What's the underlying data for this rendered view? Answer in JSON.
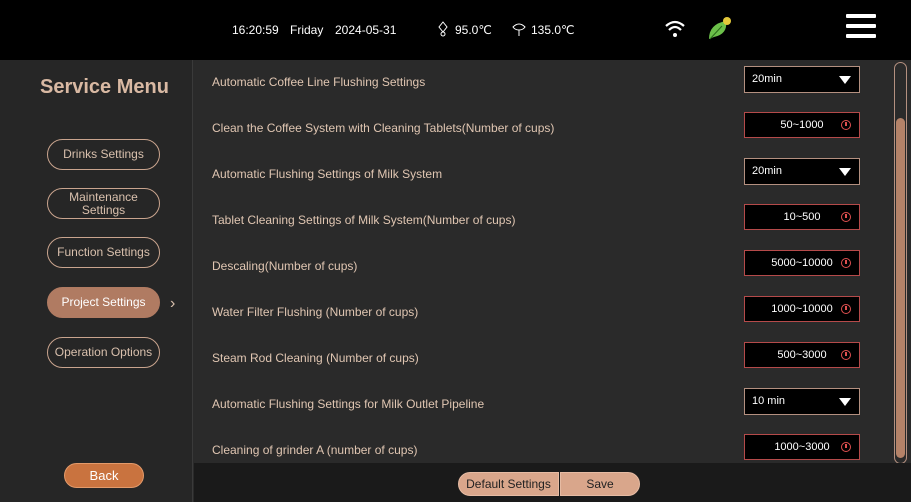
{
  "status_bar": {
    "time": "16:20:59",
    "day": "Friday",
    "date": "2024-05-31",
    "boiler_temp": "95.0℃",
    "steam_temp": "135.0℃",
    "icons": [
      "boiler-icon",
      "steam-icon",
      "wifi-icon",
      "leaf-icon",
      "hamburger-menu-icon"
    ]
  },
  "sidebar": {
    "title": "Service Menu",
    "items": [
      {
        "label": "Drinks Settings"
      },
      {
        "label": "Maintenance Settings"
      },
      {
        "label": "Function Settings"
      },
      {
        "label": "Project Settings",
        "active": true
      },
      {
        "label": "Operation Options"
      }
    ],
    "back_label": "Back"
  },
  "settings": [
    {
      "label": "Automatic Coffee Line Flushing Settings",
      "type": "dropdown",
      "value": "20min"
    },
    {
      "label": "Clean the Coffee System with Cleaning Tablets(Number of cups)",
      "type": "number",
      "placeholder": "50~1000"
    },
    {
      "label": "Automatic Flushing Settings of Milk System",
      "type": "dropdown",
      "value": "20min"
    },
    {
      "label": "Tablet Cleaning Settings of Milk System(Number of cups)",
      "type": "number",
      "placeholder": "10~500"
    },
    {
      "label": "Descaling(Number of cups)",
      "type": "number",
      "placeholder": "5000~10000"
    },
    {
      "label": "Water Filter Flushing (Number of cups)",
      "type": "number",
      "placeholder": "1000~10000"
    },
    {
      "label": "Steam Rod Cleaning (Number of cups)",
      "type": "number",
      "placeholder": "500~3000"
    },
    {
      "label": "Automatic Flushing Settings for Milk Outlet Pipeline",
      "type": "dropdown",
      "value": "10 min"
    },
    {
      "label": "Cleaning of grinder A (number of cups)",
      "type": "number",
      "placeholder": "1000~3000"
    }
  ],
  "bottom_bar": {
    "default_label": "Default Settings",
    "save_label": "Save"
  },
  "colors": {
    "accent": "#b07b62",
    "back_button": "#c9733f",
    "warning": "#e05050",
    "leaf": "#6cc04a"
  }
}
